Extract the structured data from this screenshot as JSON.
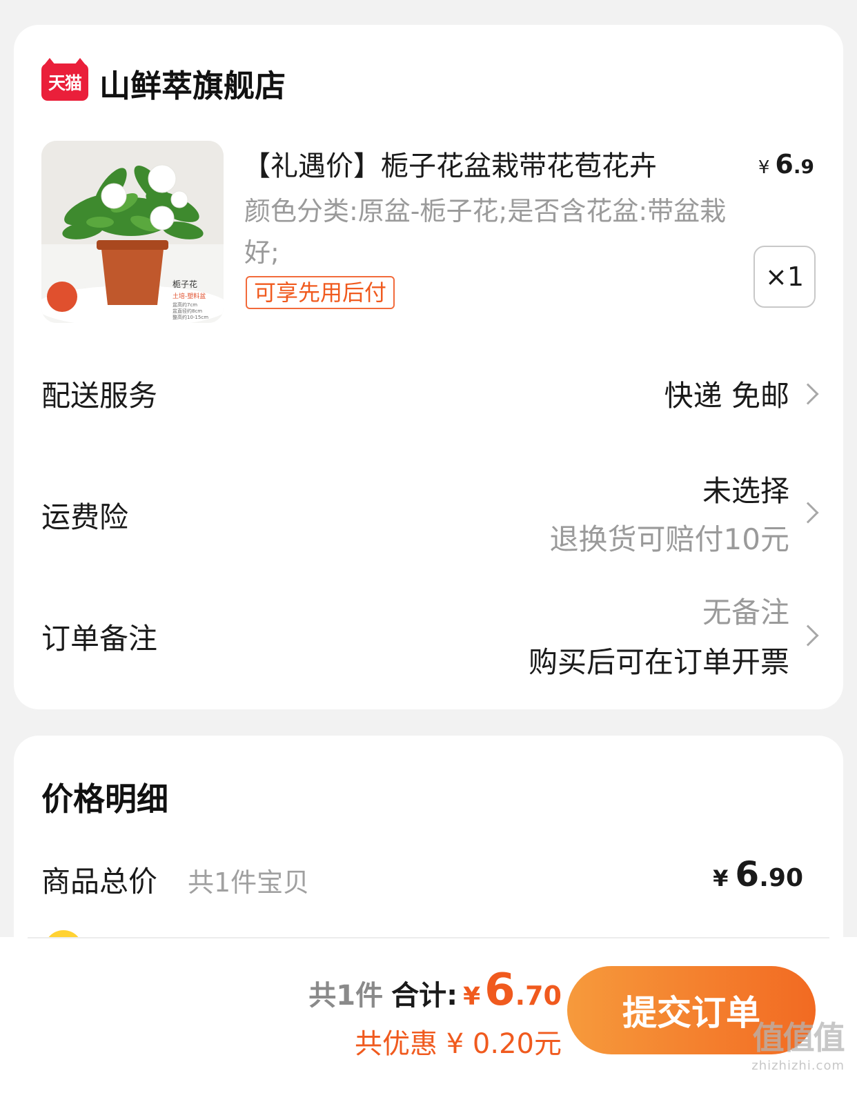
{
  "shop": {
    "logo_text": "天猫",
    "name": "山鲜萃旗舰店"
  },
  "product": {
    "title": "【礼遇价】栀子花盆栽带花苞花卉",
    "price_symbol": "¥",
    "price_int": "6",
    "price_dec": ".9",
    "sku": "颜色分类:原盆-栀子花;是否含花盆:带盆栽好;",
    "pay_later_tag": "可享先用后付",
    "quantity": "×1",
    "image_label": "栀子花",
    "image_sub": "土培-塑料盆",
    "image_spec": [
      "盆高约7cm",
      "盆直径约8cm",
      "整高约10-15cm"
    ]
  },
  "rows": {
    "delivery": {
      "label": "配送服务",
      "value": "快递 免邮"
    },
    "insurance": {
      "label": "运费险",
      "value": "未选择",
      "sub": "退换货可赔付10元"
    },
    "note": {
      "label": "订单备注",
      "value": "无备注",
      "sub": "购买后可在订单开票"
    }
  },
  "price_detail": {
    "title": "价格明细",
    "total_label": "商品总价",
    "total_count": "共1件宝贝",
    "total_symbol": "¥",
    "total_int": "6",
    "total_dec": ".90"
  },
  "bottom": {
    "count": "共1件",
    "sum_label": "合计:",
    "sum_symbol": "¥",
    "sum_int": "6",
    "sum_dec": ".70",
    "discount": "共优惠 ¥ 0.20元",
    "submit_label": "提交订单"
  },
  "watermark": {
    "main": "值值值",
    "url": "zhizhizhi.com"
  },
  "colors": {
    "accent": "#f05a1e",
    "tmall_red": "#ea1f3a",
    "button_start": "#f69a3c",
    "button_end": "#f26a22"
  },
  "icons": [
    "tmall-logo-icon",
    "chevron-right-icon",
    "coin-icon"
  ]
}
